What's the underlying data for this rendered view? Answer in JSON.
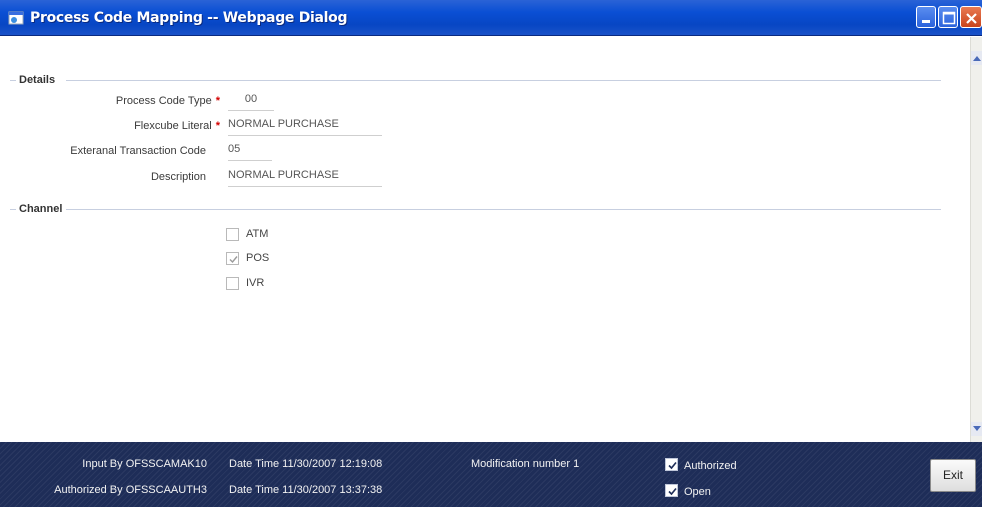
{
  "window": {
    "title": "Process Code Mapping -- Webpage Dialog"
  },
  "details": {
    "section_label": "Details",
    "process_code_type": {
      "label": "Process Code Type",
      "value": "00"
    },
    "flexcube_literal": {
      "label": "Flexcube Literal",
      "value": "NORMAL PURCHASE"
    },
    "external_transaction_code": {
      "label": "Exteranal Transaction Code",
      "value": "05"
    },
    "description": {
      "label": "Description",
      "value": "NORMAL PURCHASE"
    },
    "required_mark": "*"
  },
  "channel": {
    "section_label": "Channel",
    "options": [
      {
        "label": "ATM",
        "checked": false
      },
      {
        "label": "POS",
        "checked": true
      },
      {
        "label": "IVR",
        "checked": false
      }
    ]
  },
  "footer": {
    "input_by": "Input By OFSSCAMAK10",
    "authorized_by": "Authorized By OFSSCAAUTH3",
    "input_datetime": "Date Time 11/30/2007 12:19:08",
    "auth_datetime": "Date Time 11/30/2007 13:37:38",
    "modification": "Modification number 1",
    "authorized_label": "Authorized",
    "authorized_checked": true,
    "open_label": "Open",
    "open_checked": true,
    "exit_label": "Exit"
  },
  "colors": {
    "titlebar": "#0a4fd4",
    "footer": "#1e2d58",
    "required": "#d40000"
  }
}
